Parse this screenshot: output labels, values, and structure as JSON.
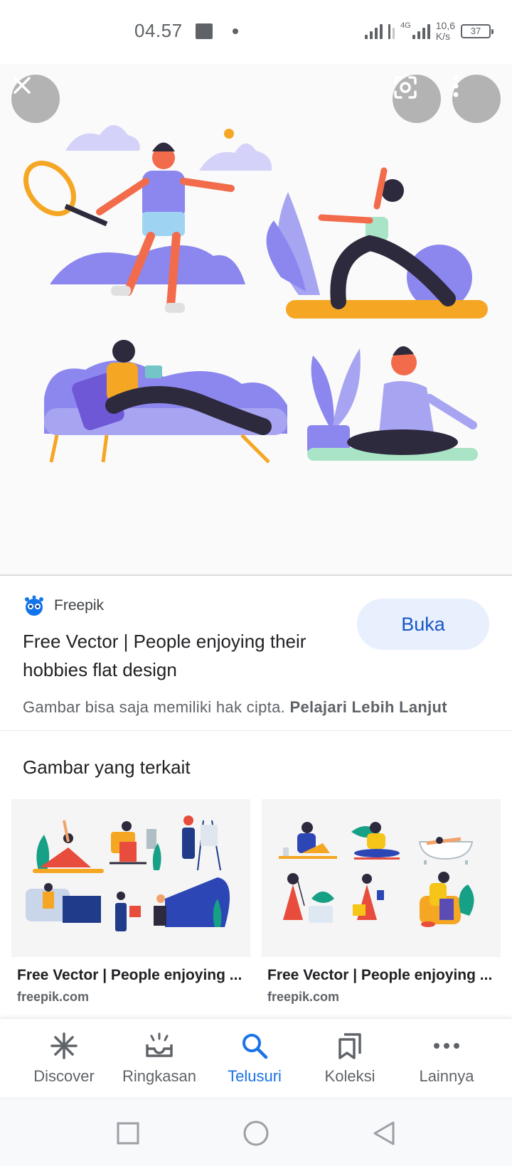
{
  "status_bar": {
    "time": "04.57",
    "network_type": "4G",
    "speed_value": "10,6",
    "speed_unit": "K/s",
    "battery": "37"
  },
  "hero": {
    "colors": {
      "purple": "#8b87ef",
      "light_purple": "#b8b5f5",
      "orange": "#f5a623",
      "coral": "#f26b4a",
      "dark": "#2e2a3d",
      "mint": "#a9e4c7"
    },
    "buttons": {
      "close_icon": "close-icon",
      "lens_icon": "lens-icon",
      "more_icon": "more-vert-icon"
    }
  },
  "result": {
    "source_name": "Freepik",
    "title": "Free Vector | People enjoying their hobbies flat design",
    "open_button": "Buka",
    "copyright_text": "Gambar bisa saja memiliki hak cipta.",
    "learn_more": "Pelajari Lebih Lanjut"
  },
  "related": {
    "heading": "Gambar yang terkait",
    "items": [
      {
        "title": "Free Vector | People enjoying ...",
        "domain": "freepik.com"
      },
      {
        "title": "Free Vector | People enjoying ...",
        "domain": "freepik.com"
      }
    ]
  },
  "tabs": [
    {
      "label": "Discover",
      "icon": "asterisk-icon",
      "active": false
    },
    {
      "label": "Ringkasan",
      "icon": "tray-icon",
      "active": false
    },
    {
      "label": "Telusuri",
      "icon": "search-icon",
      "active": true
    },
    {
      "label": "Koleksi",
      "icon": "bookmarks-icon",
      "active": false
    },
    {
      "label": "Lainnya",
      "icon": "more-horiz-icon",
      "active": false
    }
  ],
  "accent_color": "#1a73e8"
}
